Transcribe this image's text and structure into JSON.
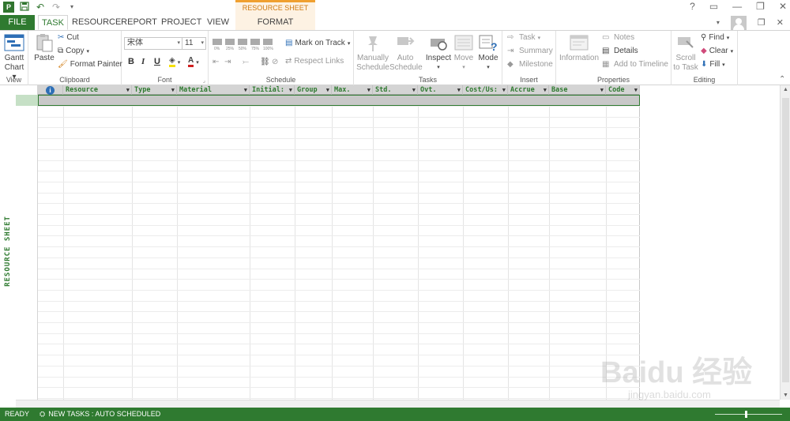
{
  "titlebar": {
    "app_logo": "P",
    "context_header": "RESOURCE SHEET TOOLS",
    "help_glyph": "?",
    "minimize_glyph": "—",
    "restore_glyph": "❐",
    "close_glyph": "✕",
    "save_glyph": "💾",
    "undo_glyph": "↶",
    "redo_glyph": "↷",
    "customize_glyph": "▾"
  },
  "tabs": {
    "file": "FILE",
    "task": "TASK",
    "resource": "RESOURCE",
    "report": "REPORT",
    "project": "PROJECT",
    "view": "VIEW",
    "format": "FORMAT"
  },
  "ribbon": {
    "view": {
      "gantt_line1": "Gantt",
      "gantt_line2": "Chart ▾",
      "label": "View"
    },
    "clipboard": {
      "paste": "Paste",
      "cut": "Cut",
      "copy": "Copy",
      "copy_dd": "▾",
      "format_painter": "Format Painter",
      "label": "Clipboard"
    },
    "font": {
      "font_name": "宋体",
      "font_size": "11",
      "bold": "B",
      "italic": "I",
      "underline": "U",
      "label": "Font"
    },
    "schedule": {
      "pct": [
        "0%",
        "25%",
        "50%",
        "75%",
        "100%"
      ],
      "mark_on_track": "Mark on Track",
      "respect_links": "Respect Links",
      "label": "Schedule"
    },
    "tasks": {
      "manually_1": "Manually",
      "manually_2": "Schedule",
      "auto_1": "Auto",
      "auto_2": "Schedule",
      "inspect": "Inspect",
      "move": "Move",
      "mode": "Mode",
      "label": "Tasks"
    },
    "insert": {
      "task": "Task",
      "summary": "Summary",
      "milestone": "Milestone",
      "label": "Insert"
    },
    "properties": {
      "information": "Information",
      "notes": "Notes",
      "details": "Details",
      "add_to_timeline": "Add to Timeline",
      "label": "Properties"
    },
    "editing": {
      "scroll_1": "Scroll",
      "scroll_2": "to Task",
      "find": "Find",
      "clear": "Clear",
      "fill": "Fill",
      "label": "Editing"
    }
  },
  "sheet": {
    "side_label": "RESOURCE SHEET",
    "info_glyph": "i",
    "columns": [
      "Resource",
      "Type",
      "Material",
      "Initial:",
      "Group",
      "Max.",
      "Std.",
      "Ovt.",
      "Cost/Us:",
      "Accrue",
      "Base",
      "Code"
    ]
  },
  "status": {
    "ready": "READY",
    "new_tasks": "NEW TASKS : AUTO SCHEDULED"
  },
  "watermark": {
    "brand": "Baidu 经验",
    "sub": "jingyan.baidu.com"
  },
  "colors": {
    "accent": "#2f7a30",
    "context": "#f0a030",
    "info": "#2e6fb6"
  }
}
